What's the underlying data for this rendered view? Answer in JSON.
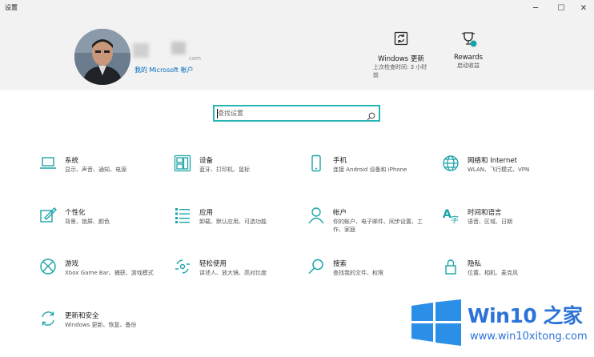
{
  "window": {
    "title": "设置",
    "minimize_glyph": "─",
    "maximize_glyph": "☐",
    "close_glyph": "✕"
  },
  "account": {
    "email_suffix": "com",
    "link": "我的 Microsoft 帐户"
  },
  "header_tiles": {
    "update": {
      "title": "Windows 更新",
      "sub1": "上次检查时间: 3 小时",
      "sub2": "前",
      "icon": "sync-icon"
    },
    "rewards": {
      "title": "Rewards",
      "sub": "启动收益",
      "icon": "trophy-icon"
    }
  },
  "search": {
    "placeholder": "查找设置"
  },
  "accent_color": "#1ba3a8",
  "settings": [
    {
      "name": "系统",
      "desc": "显示、声音、通知、电源",
      "icon": "laptop-icon"
    },
    {
      "name": "设备",
      "desc": "蓝牙、打印机、鼠标",
      "icon": "keyboard-icon"
    },
    {
      "name": "手机",
      "desc": "连接 Android 设备和 iPhone",
      "icon": "phone-icon"
    },
    {
      "name": "网络和 Internet",
      "desc": "WLAN、飞行模式、VPN",
      "icon": "globe-icon"
    },
    {
      "name": "个性化",
      "desc": "背景、锁屏、颜色",
      "icon": "paint-icon"
    },
    {
      "name": "应用",
      "desc": "卸载、默认应用、可选功能",
      "icon": "apps-list-icon"
    },
    {
      "name": "帐户",
      "desc": "你的帐户、电子邮件、同步设置、工作、家庭",
      "icon": "person-icon"
    },
    {
      "name": "时间和语言",
      "desc": "语音、区域、日期",
      "icon": "language-icon"
    },
    {
      "name": "游戏",
      "desc": "Xbox Game Bar、捕获、游戏模式",
      "icon": "xbox-icon"
    },
    {
      "name": "轻松使用",
      "desc": "讲述人、放大镜、高对比度",
      "icon": "ease-of-access-icon"
    },
    {
      "name": "搜索",
      "desc": "查找我的文件、权限",
      "icon": "search-icon"
    },
    {
      "name": "隐私",
      "desc": "位置、相机、麦克风",
      "icon": "lock-icon"
    },
    {
      "name": "更新和安全",
      "desc": "Windows 更新、恢复、备份",
      "icon": "update-icon"
    }
  ],
  "watermark": {
    "brand": "Win10 之家",
    "url": "www.win10xitong.com"
  }
}
